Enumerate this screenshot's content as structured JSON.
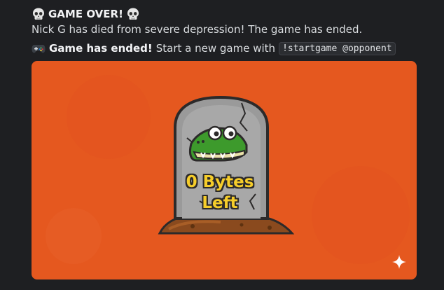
{
  "message": {
    "title": "GAME OVER!",
    "body": "Nick G has died from severe depression! The game has ended.",
    "ended_bold": "Game has ended!",
    "ended_text": "Start a new game with",
    "command": "!startgame @opponent"
  },
  "image": {
    "tombstone_text_line1": "0 Bytes",
    "tombstone_text_line2": "Left",
    "background_color": "#e5581f"
  },
  "icons": {
    "title_left": "skull-icon",
    "title_right": "skull-icon",
    "ended": "game-controller-icon",
    "corner": "sparkle-icon"
  }
}
